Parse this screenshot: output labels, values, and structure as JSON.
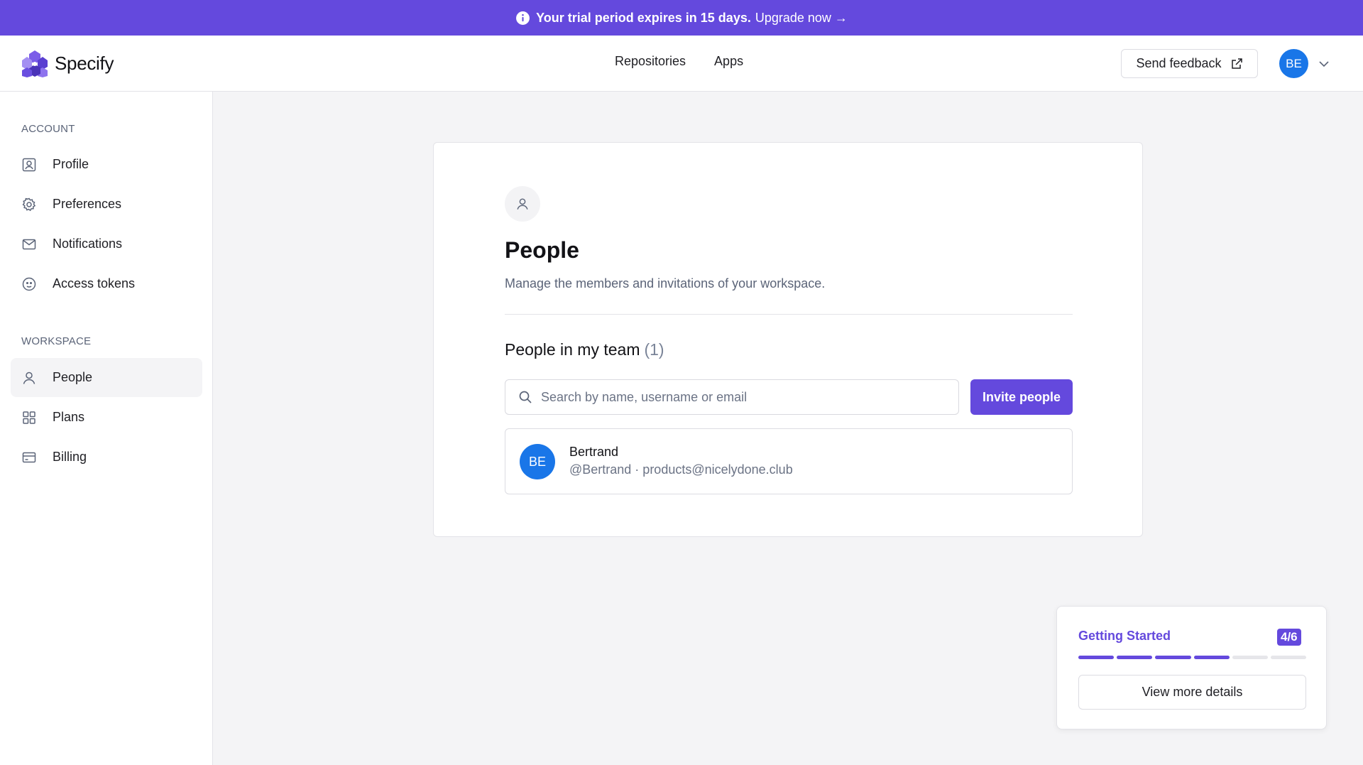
{
  "banner": {
    "trial_text": "Your trial period expires in 15 days.",
    "upgrade_text": "Upgrade now →"
  },
  "header": {
    "logo_text": "Specify",
    "nav": [
      "Repositories",
      "Apps"
    ],
    "feedback_label": "Send feedback",
    "avatar_initials": "BE"
  },
  "sidebar": {
    "account_title": "ACCOUNT",
    "account_items": [
      {
        "label": "Profile",
        "icon": "profile-icon"
      },
      {
        "label": "Preferences",
        "icon": "gear-icon"
      },
      {
        "label": "Notifications",
        "icon": "mail-icon"
      },
      {
        "label": "Access tokens",
        "icon": "token-icon"
      }
    ],
    "workspace_title": "WORKSPACE",
    "workspace_items": [
      {
        "label": "People",
        "icon": "person-icon",
        "active": true
      },
      {
        "label": "Plans",
        "icon": "grid-icon"
      },
      {
        "label": "Billing",
        "icon": "card-icon"
      }
    ]
  },
  "main": {
    "title": "People",
    "subtitle": "Manage the members and invitations of your workspace.",
    "team_heading": "People in my team",
    "team_count": "(1)",
    "search_placeholder": "Search by name, username or email",
    "invite_label": "Invite people",
    "members": [
      {
        "initials": "BE",
        "name": "Bertrand",
        "meta": "@Bertrand · products@nicelydone.club"
      }
    ]
  },
  "getting_started": {
    "title": "Getting Started",
    "badge": "4/6",
    "completed": 4,
    "total": 6,
    "button_label": "View more details"
  },
  "colors": {
    "accent": "#6449dd",
    "avatar": "#1976e8"
  }
}
